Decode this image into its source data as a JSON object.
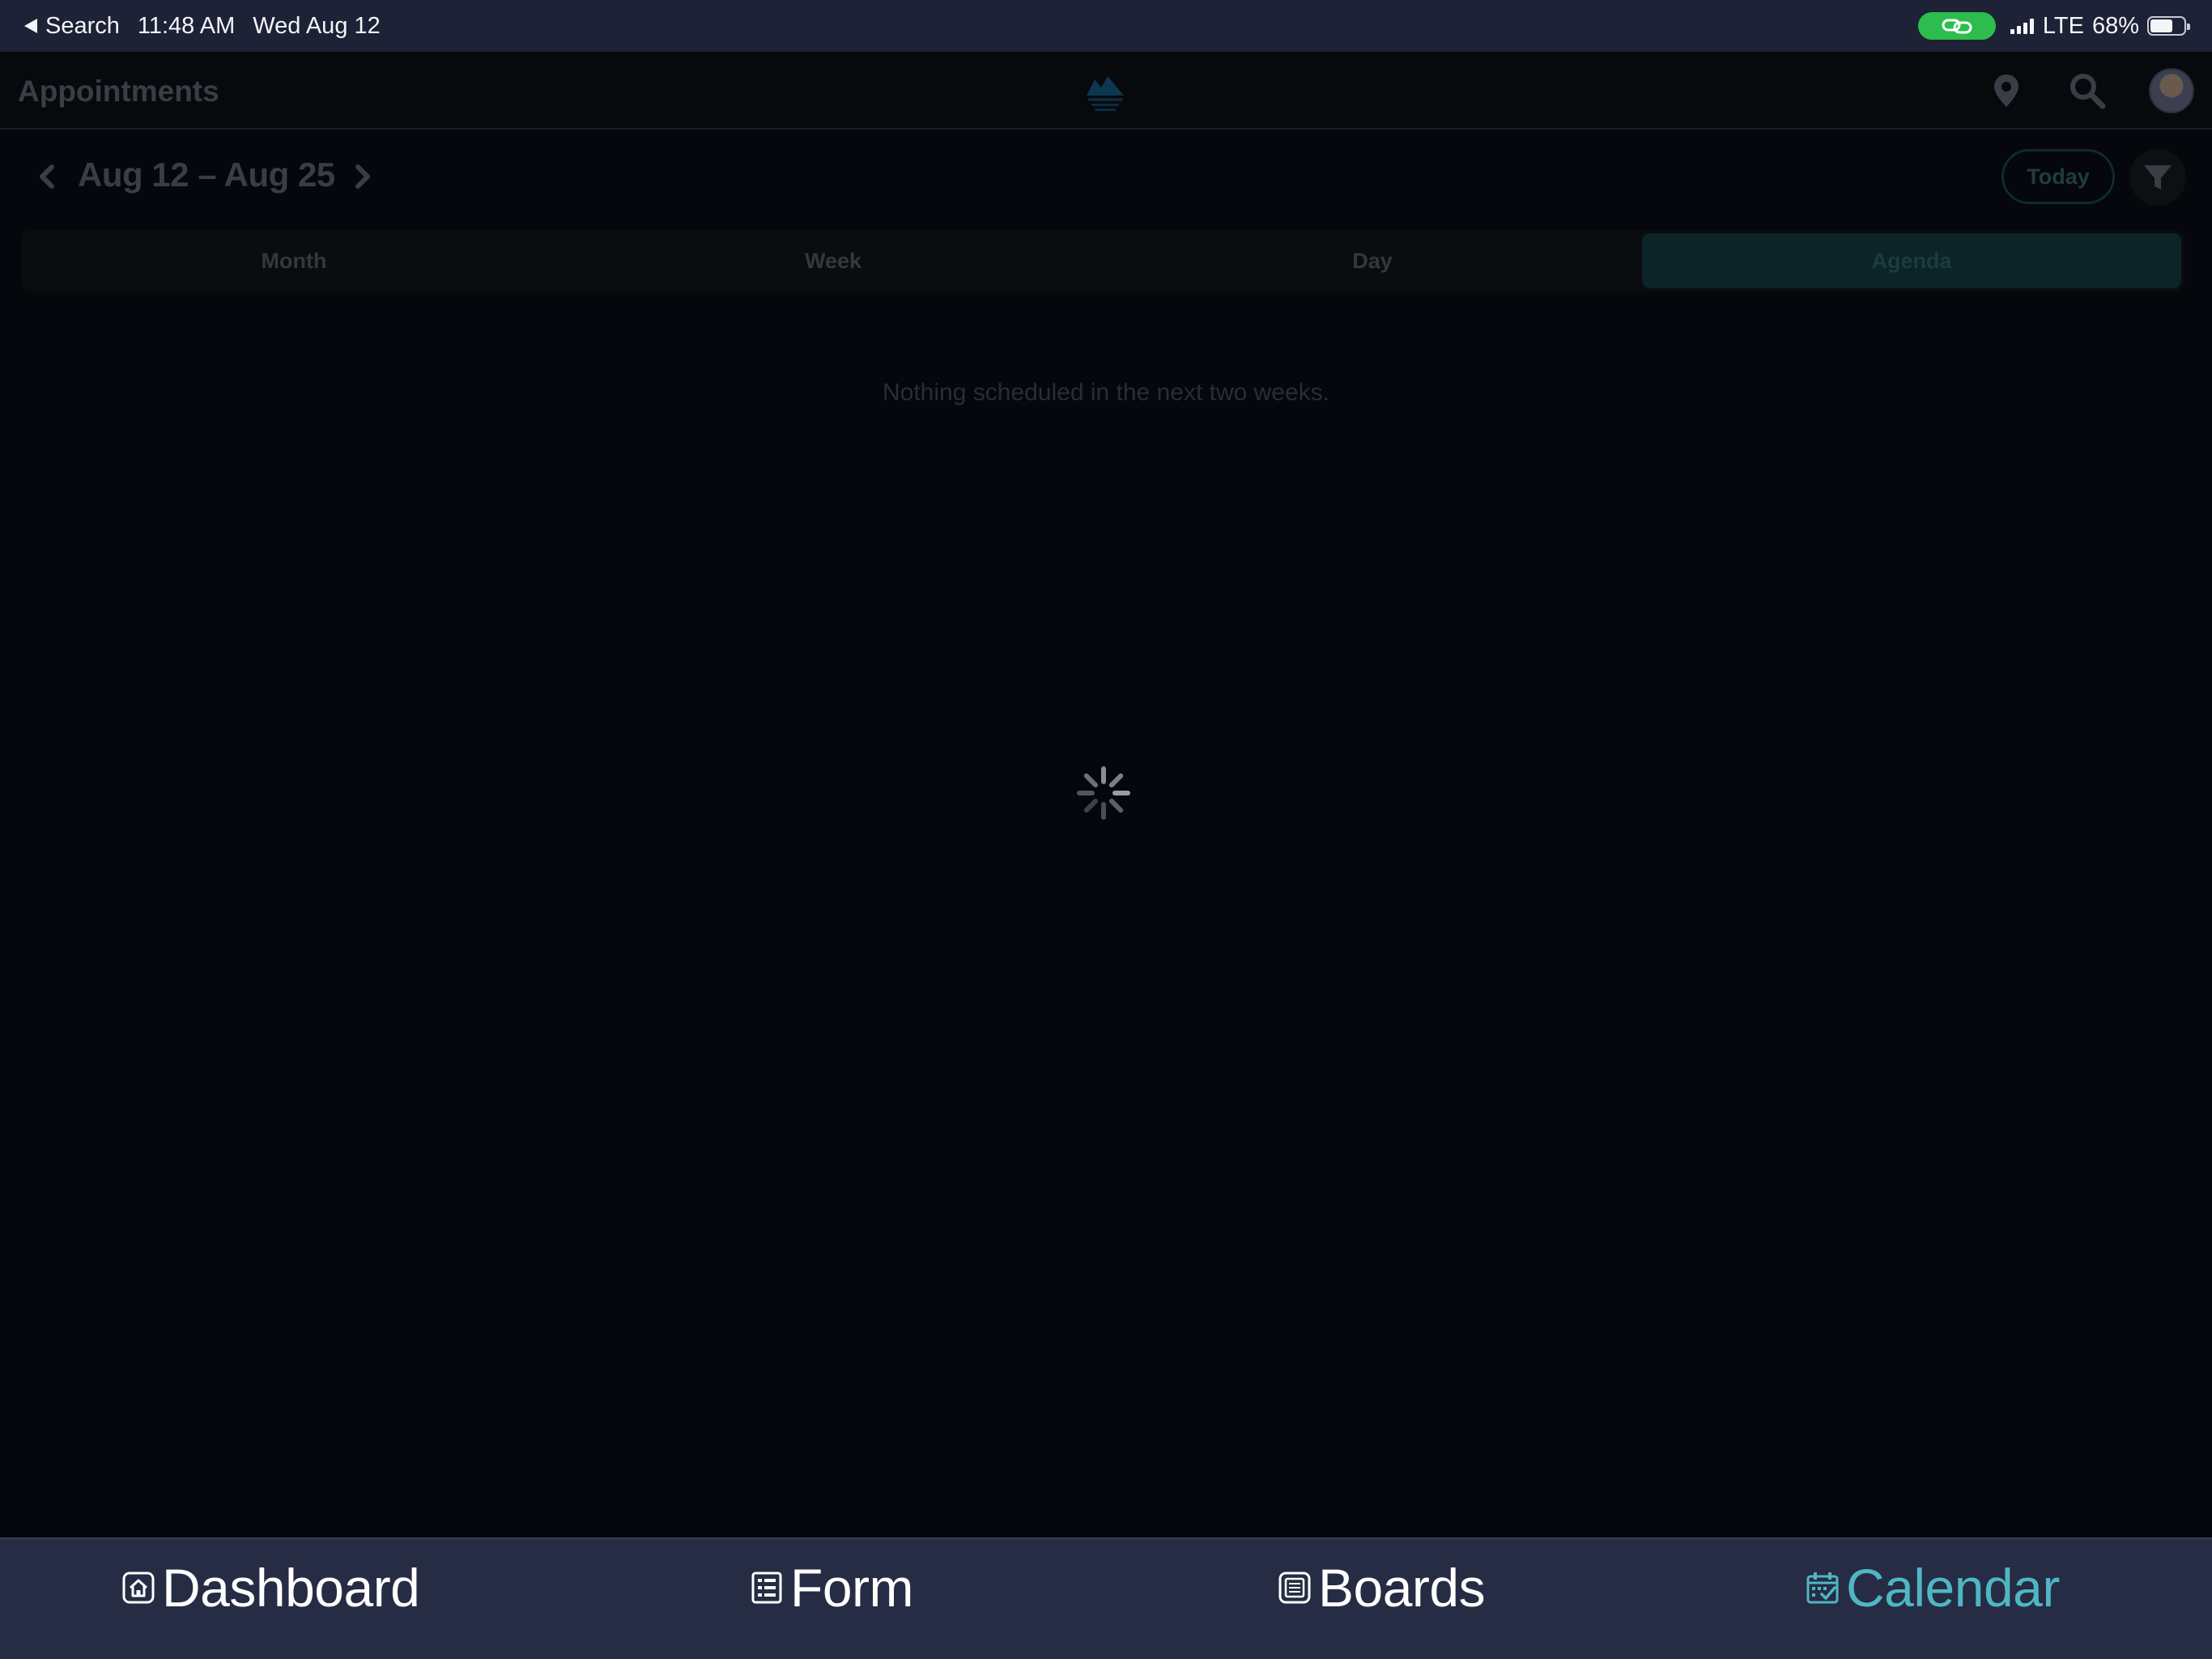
{
  "status_bar": {
    "back_label": "Search",
    "time": "11:48 AM",
    "date": "Wed Aug 12",
    "network": "LTE",
    "battery": "68%",
    "battery_level": 0.68,
    "link_pill_color": "#2dbd4e"
  },
  "header": {
    "title": "Appointments",
    "icons": [
      "location-pin-icon",
      "search-icon",
      "avatar"
    ]
  },
  "range": {
    "label": "Aug 12 – Aug 25",
    "today_label": "Today"
  },
  "view_tabs": [
    {
      "label": "Month",
      "active": false
    },
    {
      "label": "Week",
      "active": false
    },
    {
      "label": "Day",
      "active": false
    },
    {
      "label": "Agenda",
      "active": true
    }
  ],
  "content": {
    "empty_message": "Nothing scheduled in the next two weeks.",
    "loading": true
  },
  "tab_bar": {
    "items": [
      {
        "label": "Dashboard",
        "icon": "home-icon",
        "active": false
      },
      {
        "label": "Form",
        "icon": "form-icon",
        "active": false
      },
      {
        "label": "Boards",
        "icon": "boards-icon",
        "active": false
      },
      {
        "label": "Calendar",
        "icon": "calendar-check-icon",
        "active": true
      }
    ]
  },
  "colors": {
    "accent": "#4fb6c4",
    "tabbar_bg": "#262c43",
    "status_bg": "#1d2236",
    "page_bg": "#05070c"
  }
}
